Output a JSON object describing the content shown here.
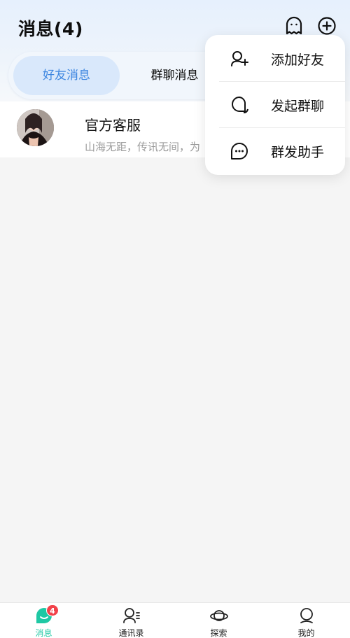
{
  "header": {
    "title": "消息(4)",
    "icons": [
      "ghost-icon",
      "plus-circle-icon"
    ]
  },
  "tabs": [
    {
      "label": "好友消息",
      "active": true
    },
    {
      "label": "群聊消息",
      "active": false
    }
  ],
  "conversations": [
    {
      "name": "官方客服",
      "preview": "山海无距，传讯无间，为"
    }
  ],
  "menu": {
    "items": [
      {
        "label": "添加好友",
        "icon": "add-user-icon"
      },
      {
        "label": "发起群聊",
        "icon": "chat-bubbles-icon"
      },
      {
        "label": "群发助手",
        "icon": "chat-dots-icon"
      }
    ]
  },
  "bottom_nav": {
    "items": [
      {
        "label": "消息",
        "icon": "message-icon",
        "active": true,
        "badge": "4"
      },
      {
        "label": "通讯录",
        "icon": "contacts-icon",
        "active": false
      },
      {
        "label": "探索",
        "icon": "planet-icon",
        "active": false
      },
      {
        "label": "我的",
        "icon": "profile-icon",
        "active": false
      }
    ]
  },
  "colors": {
    "accent": "#3d86e0",
    "tab_active_bg": "#d9e8fb",
    "nav_active": "#1fc8a4",
    "badge": "#f2424a"
  }
}
